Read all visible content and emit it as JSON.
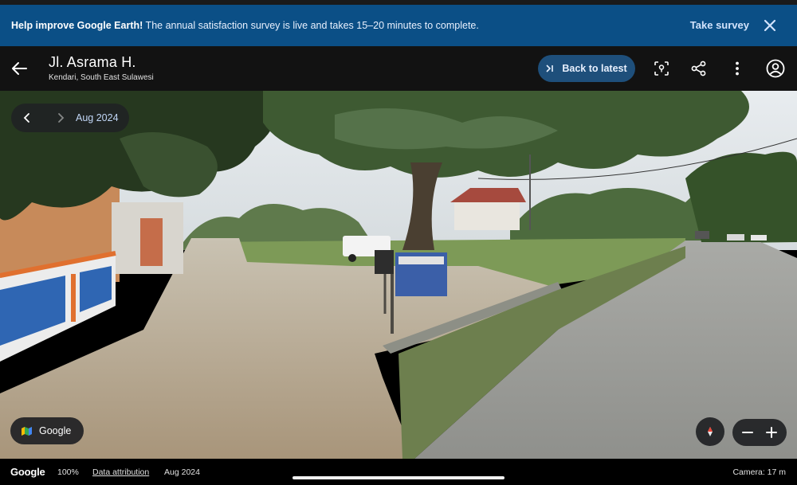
{
  "banner": {
    "bold_text": "Help improve Google Earth!",
    "text": " The annual satisfaction survey is live and takes 15–20 minutes to complete.",
    "action_label": "Take survey",
    "close_icon": "close-icon"
  },
  "header": {
    "title": "Jl. Asrama H.",
    "subtitle": "Kendari, South East Sulawesi",
    "back_to_latest_label": "Back to latest",
    "icons": [
      "back-arrow-icon",
      "photo-sphere-icon",
      "share-icon",
      "more-vert-icon",
      "account-icon"
    ]
  },
  "timeline": {
    "date": "Aug 2024"
  },
  "controls": {
    "google_pill_label": "Google"
  },
  "footer": {
    "logo": "Google",
    "zoom": "100%",
    "attribution": "Data attribution",
    "date": "Aug 2024",
    "camera": "Camera: 17 m"
  },
  "colors": {
    "banner_bg": "#0b4f86",
    "header_bg": "#121212",
    "accent_button": "#1e4f7b"
  }
}
